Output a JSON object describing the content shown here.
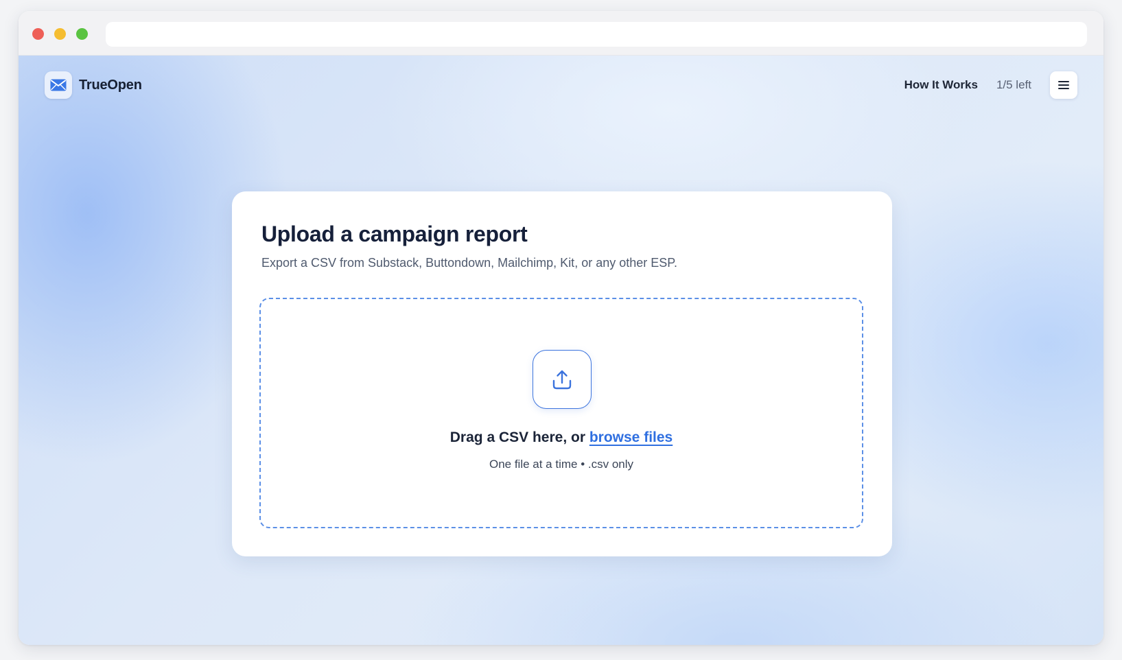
{
  "header": {
    "brand_name": "TrueOpen",
    "nav_link": "How It Works",
    "quota": "1/5 left"
  },
  "upload_card": {
    "title": "Upload a campaign report",
    "subtitle": "Export a CSV from Substack, Buttondown, Mailchimp, Kit, or any other ESP.",
    "dropzone": {
      "prompt": "Drag a CSV here, or ",
      "browse_label": "browse files",
      "hint": "One file at a time • .csv only"
    }
  },
  "icons": {
    "logo": "envelope-icon",
    "menu": "hamburger-menu-icon",
    "upload": "upload-icon"
  },
  "colors": {
    "accent": "#2f6fe0",
    "dropzone_border": "#5b8fe6",
    "heading": "#16203a"
  }
}
